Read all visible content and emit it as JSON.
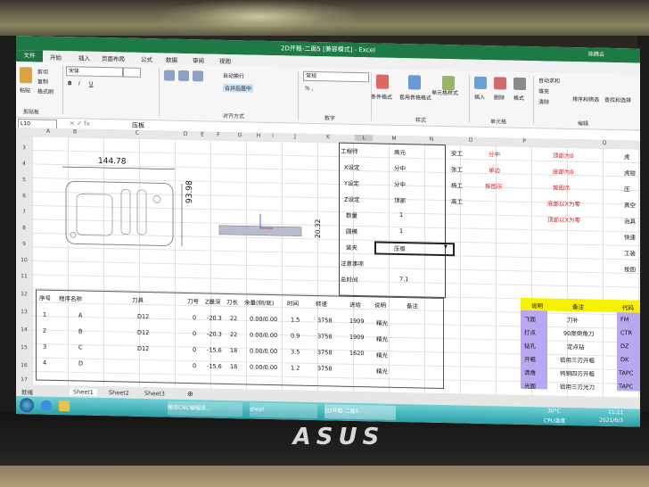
{
  "excel": {
    "window_title": "2D开粗-二面5 [兼容模式] - Excel",
    "user": "陈腾云",
    "tabs": [
      "文件",
      "开始",
      "插入",
      "页面布局",
      "公式",
      "数据",
      "审阅",
      "视图"
    ],
    "ribbon": {
      "paste": "粘贴",
      "cut": "剪切",
      "copy": "复制",
      "format_painter": "格式刷",
      "clipboard_group": "剪贴板",
      "font_name": "宋体",
      "wrap_text": "自动换行",
      "merge_center": "合并后居中",
      "alignment_group": "对齐方式",
      "number_format": "常规",
      "number_group": "数字",
      "cond_format": "条件格式",
      "table_format": "套用表格格式",
      "cell_styles": "单元格样式",
      "styles_group": "样式",
      "insert": "插入",
      "delete": "删除",
      "format": "格式",
      "cells_group": "单元格",
      "autosum": "自动求和",
      "fill": "填充",
      "clear": "清除",
      "sort_filter": "排序和筛选",
      "find_select": "查找和选择",
      "editing_group": "编辑"
    },
    "name_box": "L10",
    "formula_value": "压板",
    "columns": [
      "A",
      "B",
      "C",
      "D",
      "E",
      "F",
      "G",
      "H",
      "I",
      "J",
      "K",
      "L",
      "M",
      "N",
      "O",
      "P",
      "Q"
    ],
    "rows": [
      "3",
      "4",
      "5",
      "6",
      "7",
      "8",
      "9",
      "10",
      "11",
      "12",
      "13",
      "14",
      "15",
      "16",
      "17"
    ],
    "drawing": {
      "width": "144.78",
      "height": "93.98",
      "depth": "20.32"
    },
    "params": [
      {
        "label": "工程师",
        "value": "高元"
      },
      {
        "label": "X设定",
        "value": "分中"
      },
      {
        "label": "Y设定",
        "value": "分中"
      },
      {
        "label": "Z设定",
        "value": "顶部"
      },
      {
        "label": "数量",
        "value": "1"
      },
      {
        "label": "圆模",
        "value": "1"
      },
      {
        "label": "装夹",
        "value": "压板"
      },
      {
        "label": "注意事项",
        "value": ""
      },
      {
        "label": "总时间",
        "value": "7.1"
      }
    ],
    "side_list": [
      {
        "a": "安工",
        "b": "分中",
        "c": "顶部为0"
      },
      {
        "a": "张工",
        "b": "单边",
        "c": "底部为0"
      },
      {
        "a": "杨工",
        "b": "按图示",
        "c": "按图示"
      },
      {
        "a": "高工",
        "b": "",
        "c": "底部以X为零"
      },
      {
        "a": "",
        "b": "",
        "c": "顶部以X为零"
      }
    ],
    "right_col": [
      "虎",
      "虎钳",
      "压",
      "真空",
      "治具",
      "快速",
      "工装",
      "按图"
    ],
    "table_headers": [
      "序号",
      "程序名称",
      "刀具",
      "刀号",
      "Z最深",
      "刀长",
      "余量(侧/底)",
      "时间",
      "转速",
      "进给",
      "说明",
      "备注"
    ],
    "table_rows": [
      [
        "1",
        "A",
        "D12",
        "0",
        "-20.3",
        "22",
        "0.00/0.00",
        "1.5",
        "3758",
        "1909",
        "精光"
      ],
      [
        "2",
        "B",
        "D12",
        "0",
        "-20.3",
        "22",
        "0.00/0.00",
        "0.9",
        "3758",
        "1909",
        "精光"
      ],
      [
        "3",
        "C",
        "D12",
        "0",
        "-15.6",
        "18",
        "0.00/0.00",
        "3.5",
        "3758",
        "1620",
        "精光"
      ],
      [
        "4",
        "D",
        "",
        "0",
        "-15.6",
        "18",
        "0.00/0.00",
        "1.2",
        "3758",
        "",
        "精光"
      ]
    ],
    "legend_headers": [
      "说明",
      "备注",
      "代码"
    ],
    "legend_rows": [
      [
        "飞面",
        "刀补",
        "FM"
      ],
      [
        "打点",
        "90度倒角刀",
        "CTR"
      ],
      [
        "钻孔",
        "定点钻",
        "DZ"
      ],
      [
        "开粗",
        "铝用三刃开粗",
        "DK"
      ],
      [
        "清角",
        "钨钢四刃开粗",
        "TAPC"
      ],
      [
        "光面",
        "铝用三刃光刀",
        "TAPC"
      ]
    ],
    "sheet_tabs": [
      "Sheet1",
      "Sheet2",
      "Sheet3"
    ],
    "status_ready": "就绪"
  },
  "taskbar": {
    "items": [
      "微信CNC编程班...",
      "sheet",
      "2D开粗-二面5 - ..."
    ],
    "weather": "30°C",
    "cpu": "CPU温度",
    "time": "11:21",
    "date": "2021/6/3"
  },
  "laptop_brand": "ASUS",
  "colors": {
    "excel_green": "#1e7a45",
    "highlight_yellow": "#f7f000",
    "legend_purple": "#b9a8ef",
    "red_text": "#d21f1f",
    "taskbar_teal": "#2c9fa8"
  }
}
